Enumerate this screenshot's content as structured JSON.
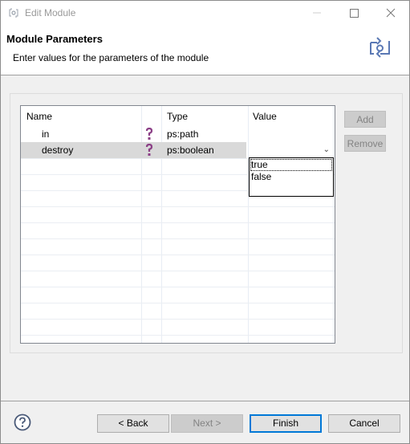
{
  "window": {
    "title": "Edit Module",
    "icons": {
      "app": "module-icon",
      "minimize": "minimize-icon",
      "maximize": "maximize-icon",
      "close": "close-icon"
    }
  },
  "header": {
    "title": "Module Parameters",
    "description": "Enter values for the parameters of the module",
    "banner_icon": "module-banner-icon"
  },
  "table": {
    "columns": [
      {
        "label": "Name"
      },
      {
        "label": ""
      },
      {
        "label": "Type"
      },
      {
        "label": "Value"
      }
    ],
    "rows": [
      {
        "name": "in",
        "icon": "question-icon",
        "type": "ps:path",
        "value": "",
        "selected": false
      },
      {
        "name": "destroy",
        "icon": "question-icon",
        "type": "ps:boolean",
        "value": "",
        "selected": true
      }
    ]
  },
  "value_dropdown": {
    "options": [
      "true",
      "false"
    ],
    "focused": "true"
  },
  "side_buttons": {
    "add": "Add",
    "remove": "Remove"
  },
  "footer": {
    "help_icon": "help-icon",
    "back": "< Back",
    "next": "Next >",
    "finish": "Finish",
    "cancel": "Cancel"
  }
}
